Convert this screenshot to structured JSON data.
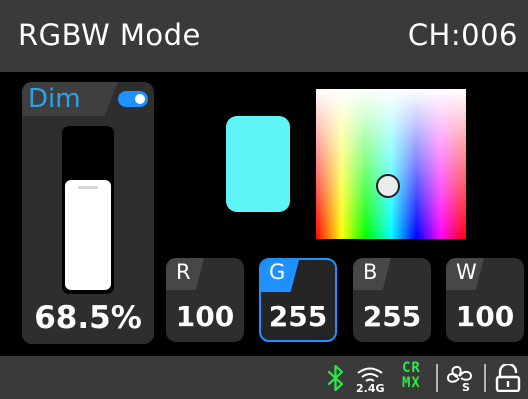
{
  "header": {
    "title": "RGBW Mode",
    "channel": "CH:006"
  },
  "dim": {
    "label": "Dim",
    "toggle_on": true,
    "value_text": "68.5%",
    "level": 0.685
  },
  "swatch_color": "#5ff4f8",
  "channels": [
    {
      "letter": "R",
      "value": "100",
      "active": false
    },
    {
      "letter": "G",
      "value": "255",
      "active": true
    },
    {
      "letter": "B",
      "value": "255",
      "active": false
    },
    {
      "letter": "W",
      "value": "100",
      "active": false
    }
  ],
  "statusbar": {
    "icons": [
      "bluetooth-icon",
      "wifi-2.4g-icon",
      "crmx-icon",
      "fan-icon",
      "lock-icon"
    ],
    "wifi_band": "2.4G",
    "crmx_label": [
      "CR",
      "MX"
    ],
    "fan_label": "S"
  },
  "colors": {
    "accent": "#1e90ff",
    "status_green": "#2ee84a",
    "dim_label": "#2aa3e8"
  }
}
